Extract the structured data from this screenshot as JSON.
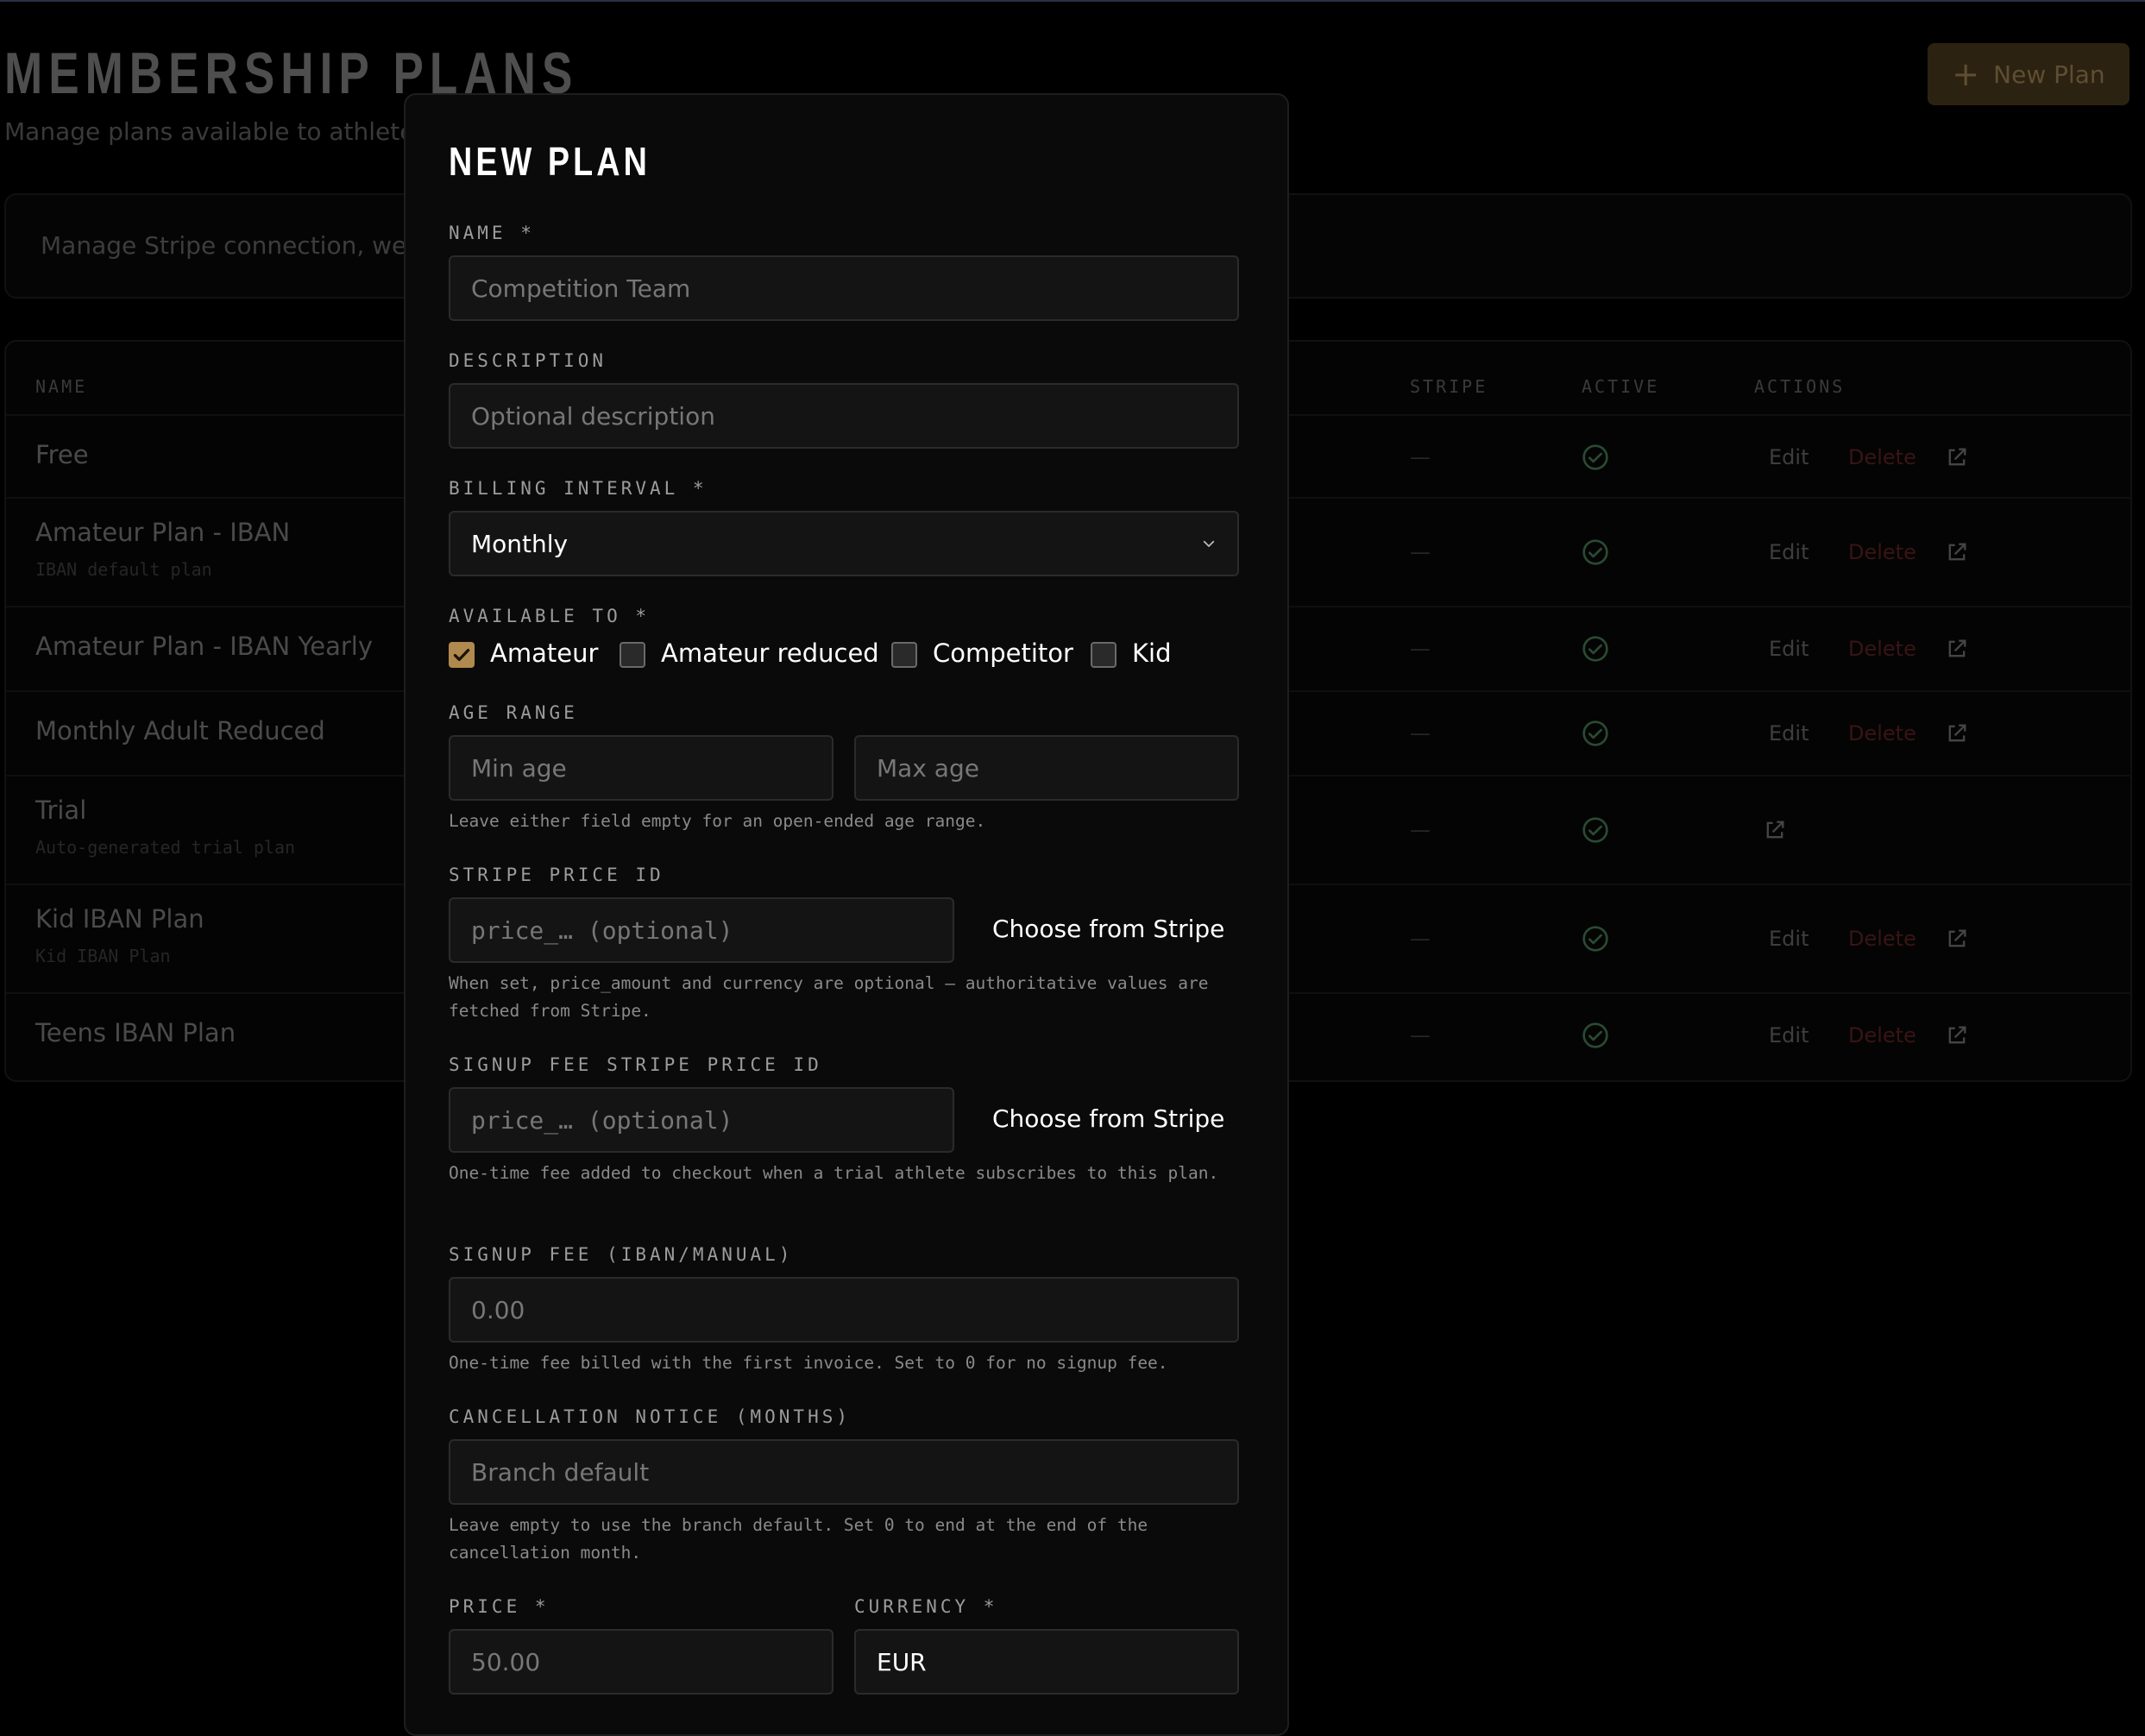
{
  "page": {
    "title": "MEMBERSHIP PLANS",
    "subtitle": "Manage plans available to athletes i",
    "new_plan_label": "New Plan",
    "stripe_card_text": "Manage Stripe connection, webh"
  },
  "table": {
    "headers": {
      "name": "NAME",
      "stripe": "STRIPE",
      "active": "ACTIVE",
      "actions": "ACTIONS"
    },
    "edit_label": "Edit",
    "delete_label": "Delete",
    "dash": "—",
    "rows": [
      {
        "name": "Free",
        "sub": ""
      },
      {
        "name": "Amateur Plan - IBAN",
        "sub": "IBAN default plan"
      },
      {
        "name": "Amateur Plan - IBAN Yearly",
        "sub": ""
      },
      {
        "name": "Monthly Adult Reduced",
        "sub": ""
      },
      {
        "name": "Trial",
        "sub": "Auto-generated trial plan"
      },
      {
        "name": "Kid IBAN Plan",
        "sub": "Kid IBAN Plan"
      },
      {
        "name": "Teens IBAN Plan",
        "sub": ""
      }
    ]
  },
  "modal": {
    "title": "NEW PLAN",
    "name_label": "NAME *",
    "name_placeholder": "Competition Team",
    "description_label": "DESCRIPTION",
    "description_placeholder": "Optional description",
    "billing_label": "BILLING INTERVAL *",
    "billing_value": "Monthly",
    "available_label": "AVAILABLE TO *",
    "available_options": [
      {
        "label": "Amateur",
        "checked": true
      },
      {
        "label": "Amateur reduced",
        "checked": false
      },
      {
        "label": "Competitor",
        "checked": false
      },
      {
        "label": "Kid",
        "checked": false
      }
    ],
    "age_label": "AGE RANGE",
    "min_age_placeholder": "Min age",
    "max_age_placeholder": "Max age",
    "age_help": "Leave either field empty for an open-ended age range.",
    "stripe_price_label": "STRIPE PRICE ID",
    "stripe_price_placeholder": "price_… (optional)",
    "choose_from_stripe": "Choose from Stripe",
    "stripe_price_help": "When set, price_amount and currency are optional — authoritative values are fetched from Stripe.",
    "signup_stripe_label": "SIGNUP FEE STRIPE PRICE ID",
    "signup_stripe_placeholder": "price_… (optional)",
    "signup_stripe_help": "One-time fee added to checkout when a trial athlete subscribes to this plan.",
    "signup_fee_label": "SIGNUP FEE (IBAN/MANUAL)",
    "signup_fee_placeholder": "0.00",
    "signup_fee_help": "One-time fee billed with the first invoice. Set to 0 for no signup fee.",
    "cancel_label": "CANCELLATION NOTICE (MONTHS)",
    "cancel_placeholder": "Branch default",
    "cancel_help": "Leave empty to use the branch default. Set 0 to end at the end of the cancellation month.",
    "price_label": "PRICE *",
    "price_placeholder": "50.00",
    "currency_label": "CURRENCY *",
    "currency_value": "EUR"
  },
  "colors": {
    "accent": "#b0894e",
    "check_active": "#2a4a32",
    "delete": "#3a1414"
  }
}
